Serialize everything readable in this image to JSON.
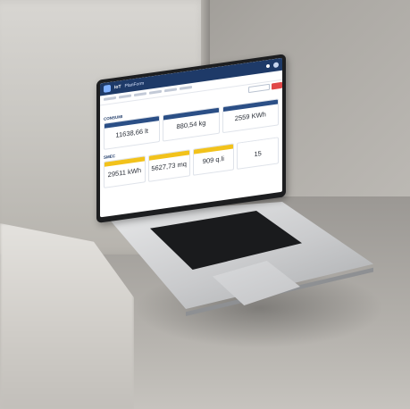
{
  "screen": {
    "brand_left": "IoT",
    "brand_right": "PlanForm",
    "sections": [
      {
        "title": "CONSUMI",
        "cards": [
          {
            "value": "11638,66 lt",
            "accent": "#2b4f86"
          },
          {
            "value": "880,54 kg",
            "accent": "#2b4f86"
          },
          {
            "value": "2559 KWh",
            "accent": "#2b4f86"
          }
        ]
      },
      {
        "title": "SMEC",
        "cards": [
          {
            "value": "29511 kWh",
            "accent": "#f2c21b"
          },
          {
            "value": "5627,73 mq",
            "accent": "#f2c21b"
          },
          {
            "value": "909 q.li",
            "accent": "#f2c21b"
          },
          {
            "value": "15",
            "accent": "#ffffff"
          }
        ]
      }
    ]
  }
}
